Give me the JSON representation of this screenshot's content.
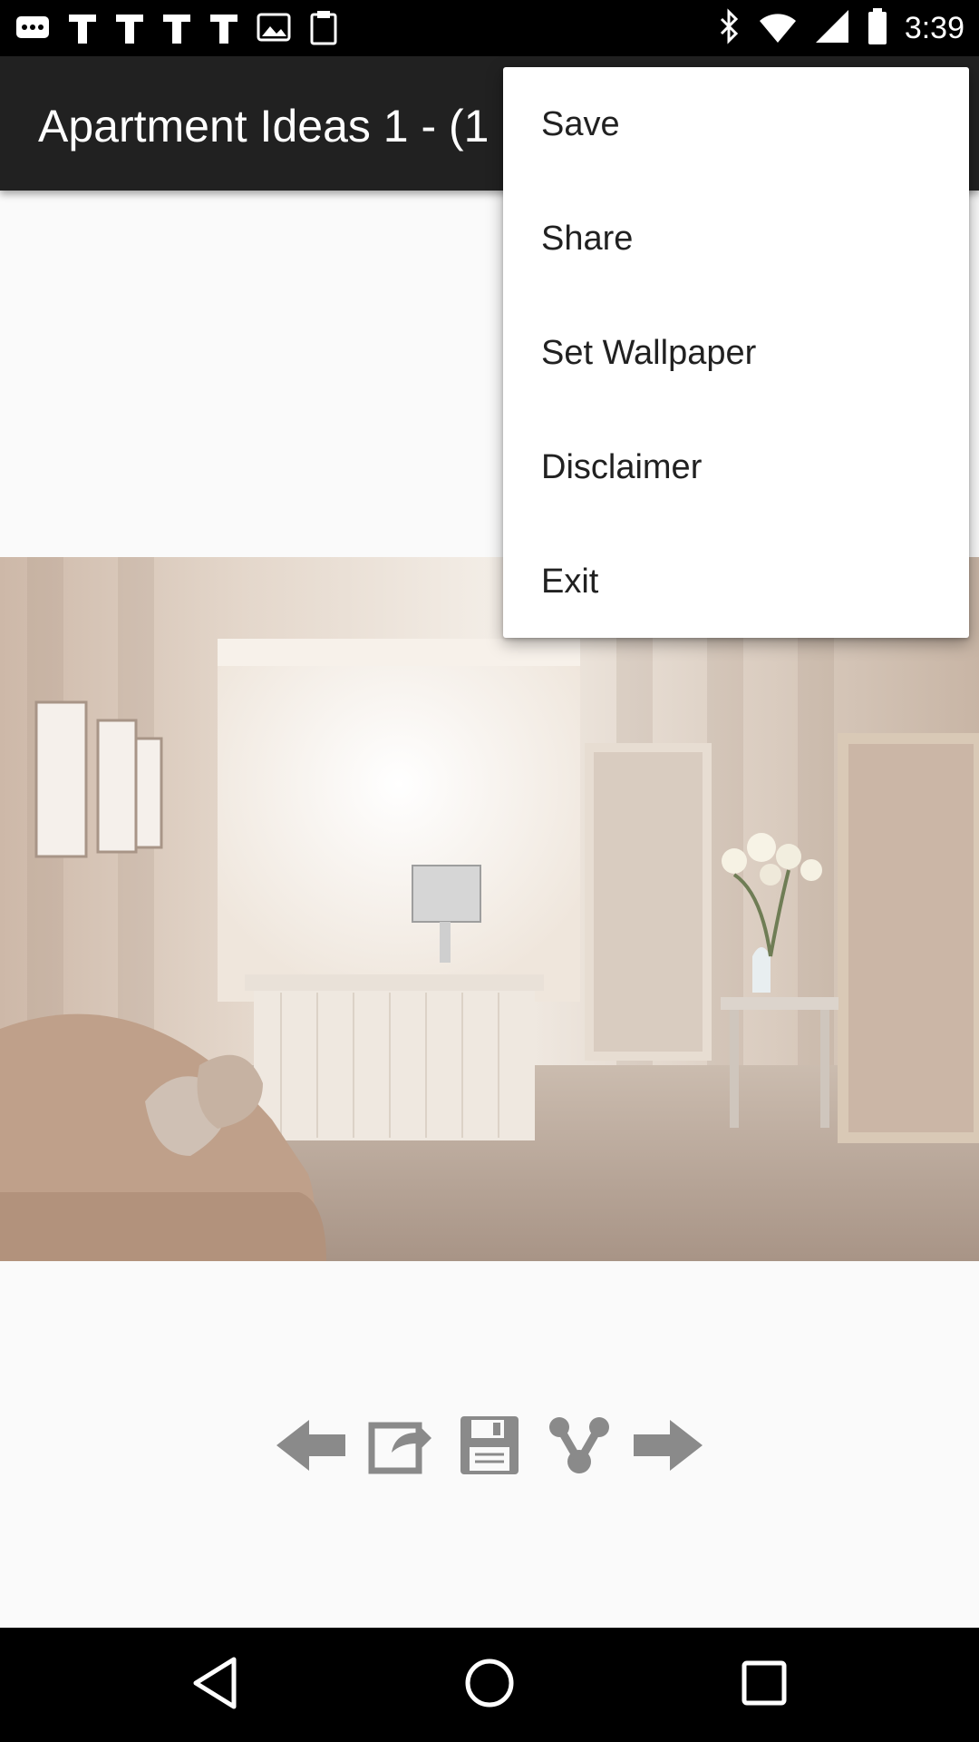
{
  "status_bar": {
    "time": "3:39",
    "icons": [
      "more-icon",
      "notification-icon",
      "notification-icon",
      "notification-icon",
      "notification-icon",
      "image-icon",
      "clipboard-icon",
      "bluetooth-icon",
      "wifi-icon",
      "signal-icon",
      "battery-icon"
    ]
  },
  "app_bar": {
    "title": "Apartment Ideas 1 - (1"
  },
  "menu": {
    "items": [
      {
        "label": "Save"
      },
      {
        "label": "Share"
      },
      {
        "label": "Set Wallpaper"
      },
      {
        "label": "Disclaimer"
      },
      {
        "label": "Exit"
      }
    ]
  },
  "toolbar": {
    "buttons": [
      "arrow-left-icon",
      "set-wallpaper-icon",
      "save-disk-icon",
      "share-icon",
      "arrow-right-icon"
    ]
  },
  "nav_bar": {
    "buttons": [
      "back-icon",
      "home-icon",
      "recents-icon"
    ]
  },
  "colors": {
    "app_bar": "#212121",
    "content_bg": "#fafafa",
    "menu_bg": "#ffffff",
    "toolbar_icon": "#8a8a8a"
  }
}
